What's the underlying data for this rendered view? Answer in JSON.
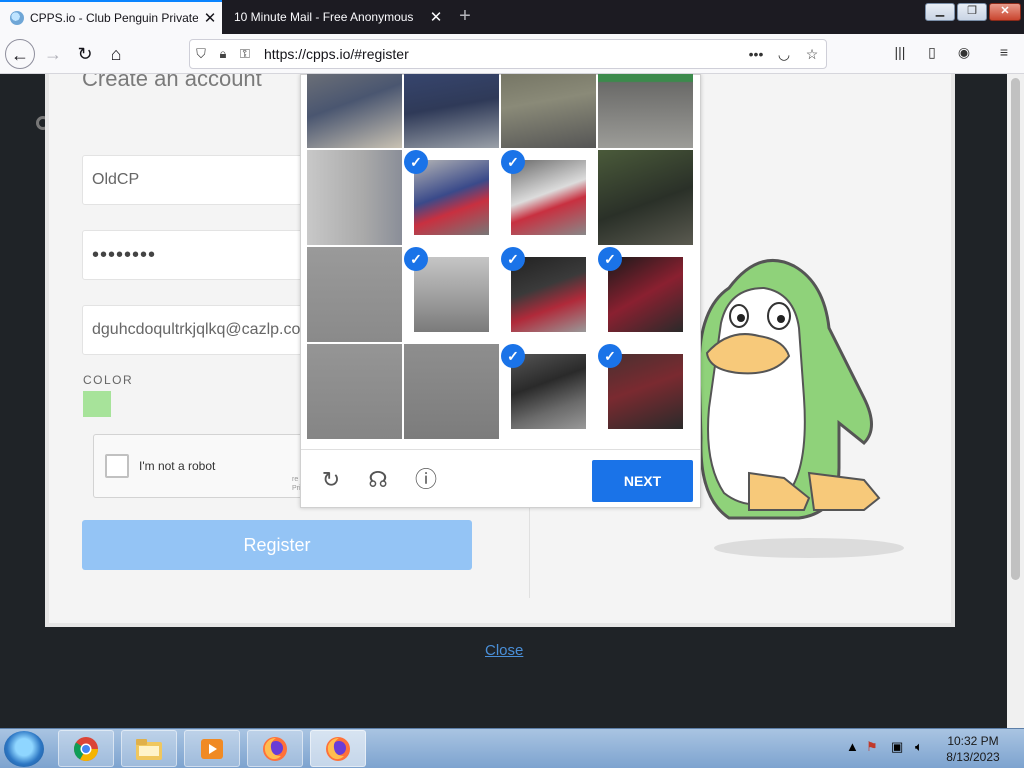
{
  "browser": {
    "tabs": [
      {
        "title": "CPPS.io - Club Penguin Private",
        "close": "✕",
        "active": true
      },
      {
        "title": "10 Minute Mail - Free Anonymous",
        "close": "✕",
        "active": false
      }
    ],
    "new_tab": "+",
    "url": "https://cpps.io/#register",
    "icons": [
      "back-icon",
      "forward-icon",
      "reload-icon",
      "home-icon",
      "shield-icon",
      "lock-icon",
      "key-icon",
      "more-icon",
      "pocket-icon",
      "star-icon",
      "library-icon",
      "sidebar-icon",
      "account-icon",
      "menu-icon"
    ]
  },
  "form": {
    "title": "Create an account",
    "username": "OldCP",
    "password": "••••••••",
    "email": "dguhcdoqultrkjqlkq@cazlp.com",
    "color_label": "COLOR",
    "color_value": "#a7e39a",
    "recaptcha_label": "I'm not a robot",
    "recaptcha_small": "reC\nPriv",
    "register_label": "Register"
  },
  "captcha": {
    "next_label": "NEXT",
    "icons": [
      "reload-icon",
      "audio-icon",
      "info-icon"
    ],
    "selected_tiles": [
      5,
      6,
      9,
      10,
      11,
      14,
      15
    ]
  },
  "close_label": "Close",
  "taskbar": {
    "time": "10:32 PM",
    "date": "8/13/2023",
    "apps": [
      "chrome-icon",
      "file-explorer-icon",
      "media-player-icon",
      "firefox-icon",
      "firefox-active-icon"
    ]
  }
}
